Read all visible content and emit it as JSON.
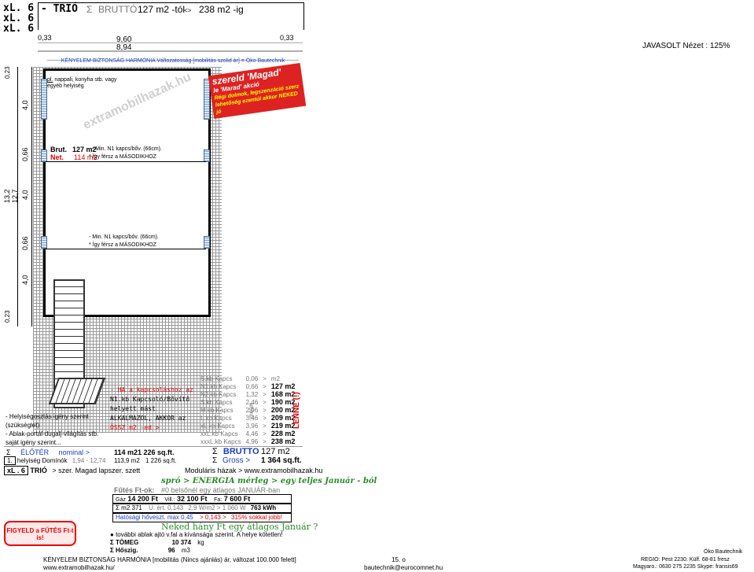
{
  "header": {
    "sizes": [
      "xL. 6",
      "xL. 6",
      "xL. 6"
    ],
    "type_label": "TRIÓ",
    "sigma": "Σ",
    "brutto_label": "BRUTTÓ",
    "range_from": "127 m2 -tól",
    "range_sep": "<>",
    "range_to": "238 m2 -ig",
    "dim_left": "0,33",
    "dim_mid_top": "9,60",
    "dim_mid_bottom": "8,94",
    "dim_right": "0,33",
    "keywords": "KÉNYELEM  BIZTONSÁG  HARMÓNIA  Változatosság  [mobilitás szolid ár] = Öko Bautechnik",
    "view_label": "JAVASOLT Nézet  :  125%"
  },
  "dimensions_left": [
    "0,23",
    "4,0",
    "0,66",
    "13,2",
    "12,7",
    "4,0",
    "0,66",
    "4,0",
    "0,23"
  ],
  "plan": {
    "room_label": "nappali, konyha stb. vagy egyéb helyiség",
    "room_prefix": "pl.",
    "brut_label": "Brut.",
    "brut_value": "127 m2",
    "net_label": "Net.",
    "net_value": "114 m2",
    "note1_a": "- Min. N1 kapcs/bőv. (66cm).",
    "note1_b": "* Így férsz  a  MÁSODIKHOZ",
    "note2_a": "- Min. N1 kapcs/bőv. (66cm).",
    "note2_b": "* Így férsz  a  MÁSODIKHOZ",
    "stamp": [
      "szereld 'Magad'",
      "le 'Marad' akció",
      "Régi dolmok, legszenzáció szerz",
      "lehetőség ezentúl akkor NEKED jó"
    ],
    "watermark": "extramobilhazak.hu"
  },
  "side_notes": {
    "needs": [
      "- Helyiségosztás igény szerint",
      "(szükséglet)",
      "- Ablak-portál-dugalj-világítás stb.",
      "saját igény szerint..."
    ],
    "connection": [
      "- HA a kapcsoláshoz az",
      "N1.kb Kapcsoló/Bővítő",
      "helyett mást",
      "ALKALMAZOL, AKKOR az",
      "ÖSSZ m2 -ed  >"
    ]
  },
  "spec_table": {
    "rows": [
      {
        "name": "S.kb Kapcs",
        "val": "0,06",
        "arrow": ">",
        "area": "m2"
      },
      {
        "name": "N1.kb Kapcs",
        "val": "0,66",
        "arrow": ">",
        "area": "127 m2"
      },
      {
        "name": "N2.kb Kapcs",
        "val": "1,32",
        "arrow": ">",
        "area": "168 m2"
      },
      {
        "name": "S.kb Kapcs",
        "val": "2,46",
        "arrow": ">",
        "area": "190 m2"
      },
      {
        "name": "M.kb Kapcs",
        "val": "2,96",
        "arrow": ">",
        "area": "200 m2"
      },
      {
        "name": "L.kb Kapcs",
        "val": "3,46",
        "arrow": ">",
        "area": "209 m2"
      },
      {
        "name": "xL.kb Kapcs",
        "val": "3,96",
        "arrow": ">",
        "area": "219 m2"
      },
      {
        "name": "xxL.kb Kapcs",
        "val": "4,46",
        "arrow": ">",
        "area": "228 m2"
      },
      {
        "name": "xxxL.kb Kapcs",
        "val": "4,96",
        "arrow": ">",
        "area": "238 m2"
      }
    ],
    "unit_vertical": "méter",
    "lenne": "LENNE (!)"
  },
  "summary": {
    "sigma": "Σ",
    "eloter": "ÉLŐTÉR",
    "nominal": "nominal >",
    "eloter_m2": "114 m2",
    "eloter_sqft": "1 226 sq.ft.",
    "helyiseg_num": "1.",
    "helyiseg_label": "helyiség Domínók",
    "helyiseg_gray": "1,94 · 12,74",
    "helyiseg_m2": "113,9 m2",
    "helyiseg_sqft": "1 226 sq.ft.",
    "brutto_label": "BRUTTO",
    "brutto_value": "127 m2",
    "gross_label": "Gross >",
    "gross_value": "1 364  sq.ft.",
    "footer_size": "xL . 6",
    "footer_type": "TRIÓ",
    "footer_link": "> szer. Magad lapszer. szett",
    "moduláris": "Moduláris házak  > www.extramobilhazak.hu"
  },
  "energy": {
    "title": "spró > ENERGIA mérleg  >  egy teljes  Január - ból",
    "futes_label": "Fűtés Ft-ok:",
    "futes_text": "#0  belsőnél egy átlagos JANUÁR-ban",
    "gaz_label": "Gáz",
    "gaz_value": "14 200 Ft",
    "vill_label": "Vill.:",
    "vill_value": "32 100 Ft",
    "fa_label": "Fa:",
    "fa_value": "7 600 Ft",
    "sum_m2": "Σ m2  371",
    "hoatb": "U. ért.  0,143",
    "wm2": "2,9 W/m2 > 1 060 W",
    "kwh": "763 kWh",
    "hatosagi": "Hatósági hőveszt. max  0,45",
    "hatosagi_cmp": ">  0,143 >",
    "hatosagi_pct": "315%  sokkal jobb!",
    "question": "Neked  hány  Ft  egy  átlagos  Január ?",
    "more": "további ablak ajtó v.fal  a kívánsága szerint. A helye kötetlen!",
    "tomeg_label": "Σ TÖMEG",
    "tomeg_value": "10 374",
    "tomeg_unit": "kg",
    "hoszig_label": "Σ Hőszig.",
    "hoszig_value": "96",
    "hoszig_unit": "m3"
  },
  "warning": "FIGYELD a FŰTÉS Ft-t is!",
  "footer": {
    "left1": "KÉNYELEM  BIZTONSÁG  HARMÓNIA  [mobilitás  (Nincs ajánlás) ár, változat 100.000 felett]",
    "left2": "www.extramobilhazak.hu/",
    "page": "15. o",
    "email": "bautechnik@eurocomnet.hu",
    "company": "Öko Bautechnik",
    "region": "REGIO: Pest  2230.  Külf. 68-81 fresz",
    "contact": "Magyaro.: 0630 275 2235  Skype: fransis69"
  }
}
